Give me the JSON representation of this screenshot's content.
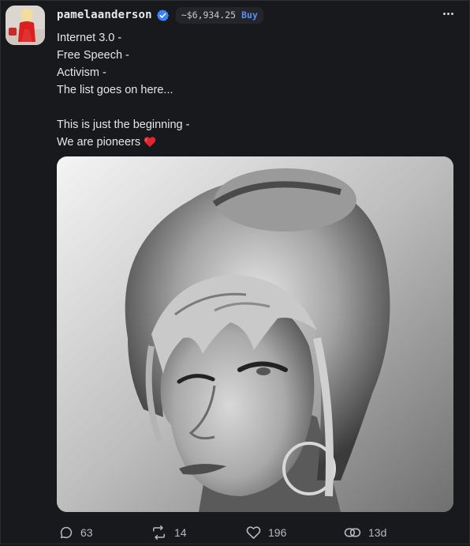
{
  "post": {
    "username": "pamelaanderson",
    "price": "~$6,934.25",
    "buy_label": "Buy",
    "lines": [
      "Internet 3.0 -",
      "Free Speech -",
      "Activism -",
      "The list goes on here...",
      "",
      "This is just the beginning -",
      "We are pioneers"
    ],
    "heart_emoji_color": "#e0262f"
  },
  "actions": {
    "replies": "63",
    "reposts": "14",
    "likes": "196",
    "age": "13d"
  },
  "icons": {
    "verified": "verified-badge-icon",
    "more": "more-options-icon",
    "reply": "comment-bubble-icon",
    "repost": "repost-arrows-icon",
    "like": "heart-outline-icon",
    "share": "link-icon"
  },
  "colors": {
    "background": "#18191d",
    "accent": "#5b8ff0",
    "verified": "#3b82f6",
    "muted_text": "#b8b9bf"
  }
}
